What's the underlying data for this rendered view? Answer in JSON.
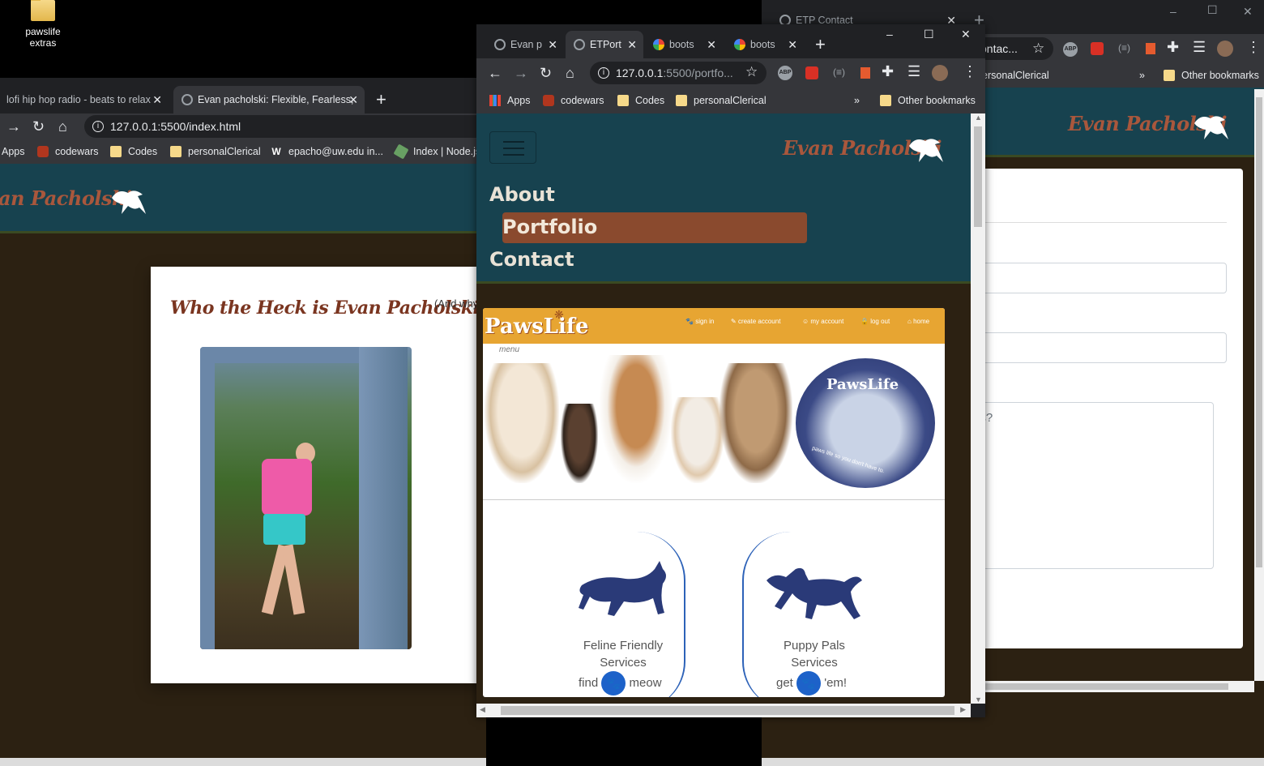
{
  "desktop": {
    "icon_label_1": "pawslife",
    "icon_label_2": "extras"
  },
  "win_left": {
    "tabs": [
      {
        "label": "lofi hip hop radio - beats to relax"
      },
      {
        "label": "Evan pacholski: Flexible, Fearless,"
      }
    ],
    "url": "127.0.0.1:5500/index.html",
    "bookmarks": [
      "Apps",
      "codewars",
      "Codes",
      "personalClerical",
      "epacho@uw.edu in...",
      "Index | Node.js"
    ],
    "brand": "an Pacholski",
    "card_title": "Who the Heck is Evan Pacholski?",
    "card_subtitle": "(And why"
  },
  "win_right": {
    "tab_label": "ETP Contact",
    "url": "ontac...",
    "bookmarks": [
      "ersonalClerical",
      "Other bookmarks"
    ],
    "brand": "Evan Pacholski",
    "textarea_placeholder": "ns?",
    "win_controls": {
      "minimize": "–",
      "maximize": "☐",
      "close": "✕"
    }
  },
  "win_center": {
    "tabs": [
      {
        "label": "Evan p"
      },
      {
        "label": "ETPort"
      },
      {
        "label": "boots"
      },
      {
        "label": "boots"
      }
    ],
    "url_main": "127.0.0.1",
    "url_rest": ":5500/portfo...",
    "bookmarks": [
      "Apps",
      "codewars",
      "Codes",
      "personalClerical",
      "Other bookmarks"
    ],
    "brand": "Evan Pacholski",
    "nav": [
      "About",
      "Portfolio",
      "Contact"
    ],
    "active_nav": "Portfolio",
    "pawslife": {
      "logo": "PawsLife",
      "header_links": [
        "sign in",
        "create account",
        "my account",
        "log out",
        "home"
      ],
      "menu_label": "menu",
      "badge_text": "PawsLife",
      "badge_caption": "paws life so you don't have to.",
      "services": [
        {
          "title_1": "Feline Friendly",
          "title_2": "Services",
          "before": "find",
          "after": "meow"
        },
        {
          "title_1": "Puppy Pals",
          "title_2": "Services",
          "before": "get",
          "after": "'em!"
        }
      ]
    }
  },
  "colors": {
    "site_teal": "#17424f",
    "site_brown": "#2c2112",
    "brand_rust": "#a9573c",
    "nav_active": "#8a4a2e",
    "pawslife_orange": "#e7a532",
    "service_blue": "#2a3a78"
  }
}
